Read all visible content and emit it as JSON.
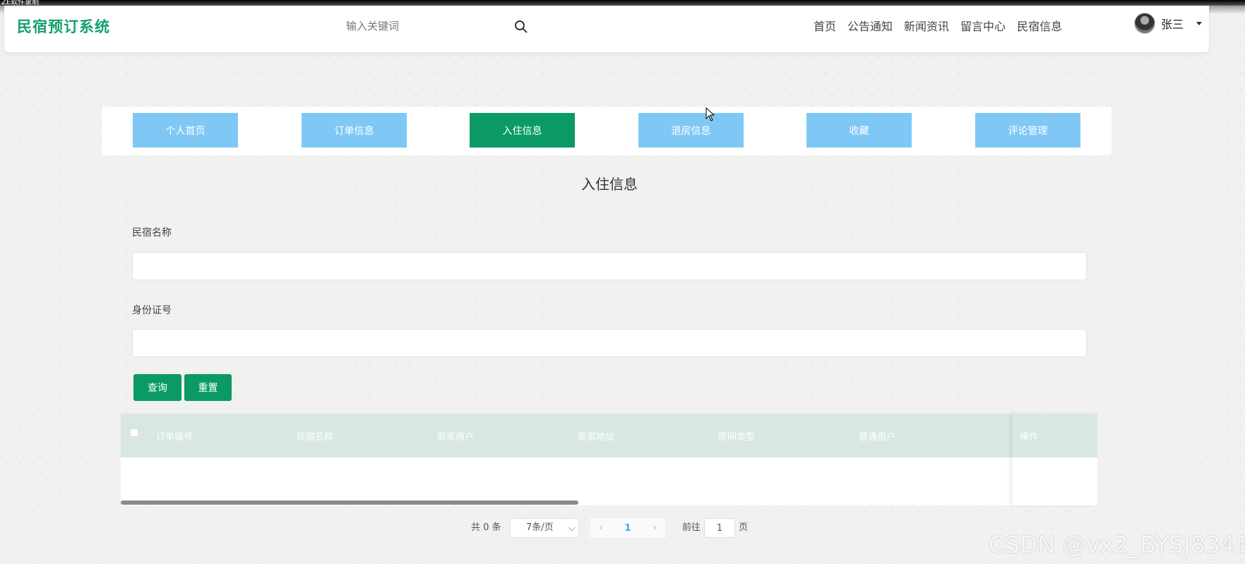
{
  "recorder": {
    "label": "ZE软件录制"
  },
  "header": {
    "logo": "民宿预订系统",
    "search_placeholder": "输入关键词",
    "nav": [
      "首页",
      "公告通知",
      "新闻资讯",
      "留言中心",
      "民宿信息"
    ],
    "user_name": "张三"
  },
  "tabs": [
    {
      "label": "个人首页",
      "active": false
    },
    {
      "label": "订单信息",
      "active": false
    },
    {
      "label": "入住信息",
      "active": true
    },
    {
      "label": "退房信息",
      "active": false
    },
    {
      "label": "收藏",
      "active": false
    },
    {
      "label": "评论管理",
      "active": false
    }
  ],
  "page_title": "入住信息",
  "form": {
    "field1_label": "民宿名称",
    "field1_value": "",
    "field2_label": "身份证号",
    "field2_value": "",
    "query_label": "查询",
    "reset_label": "重置"
  },
  "table": {
    "columns": [
      "订单编号",
      "民宿名称",
      "商家用户",
      "商家地址",
      "房间类型",
      "普通用户"
    ],
    "operation": "操作",
    "rows": []
  },
  "pagination": {
    "total": "共 0 条",
    "page_size": "7条/页",
    "current_page": "1",
    "goto_label": "前往",
    "goto_value": "1",
    "unit": "页"
  },
  "watermark": "CSDN @vx2_BYSJ8341",
  "colors": {
    "accent": "#0b9a66",
    "tab": "#7fc8f6",
    "logo": "#14a06b",
    "table_header": "#d8e8e0"
  }
}
